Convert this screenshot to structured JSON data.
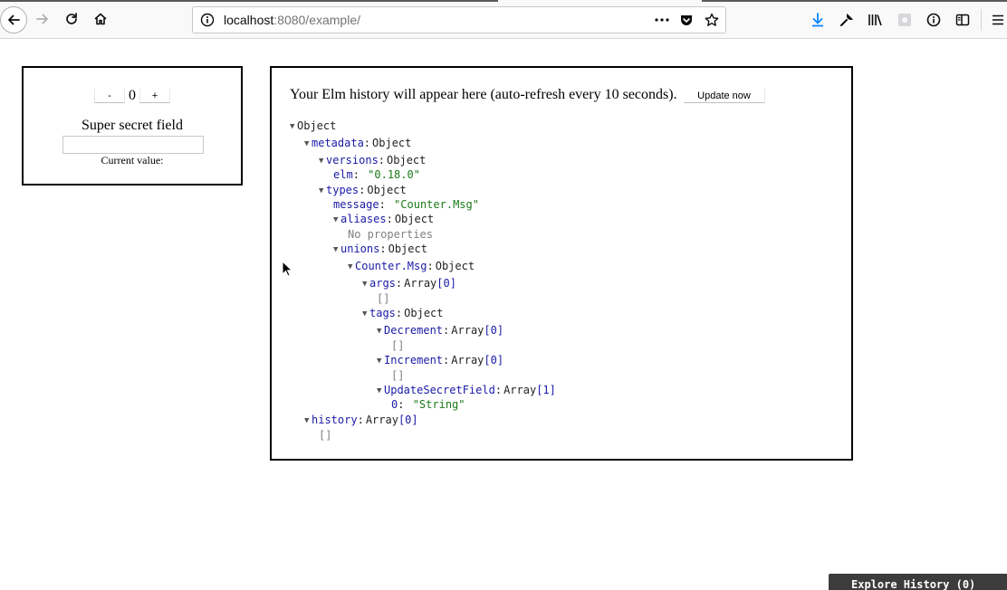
{
  "browser": {
    "url_host": "localhost",
    "url_rest": ":8080/example/",
    "icons": [
      "back-icon",
      "forward-icon",
      "reload-icon",
      "home-icon",
      "info-icon",
      "more-icon",
      "pocket-icon",
      "star-icon",
      "download-icon",
      "wrench-icon",
      "library-icon",
      "extension-icon",
      "info-circle-icon",
      "sidebar-icon",
      "menu-icon"
    ],
    "download_color": "#0a84ff"
  },
  "counter": {
    "decrement_label": "-",
    "count": "0",
    "increment_label": "+",
    "secret_label": "Super secret field",
    "secret_value": "",
    "current_value_label": "Current value:"
  },
  "history": {
    "message": "Your Elm history will appear here (auto-refresh every 10 seconds).",
    "update_label": "Update now",
    "tree": {
      "root": "Object",
      "metadata_key": "metadata",
      "metadata_type": "Object",
      "versions_key": "versions",
      "versions_type": "Object",
      "elm_key": "elm",
      "elm_value": "\"0.18.0\"",
      "types_key": "types",
      "types_type": "Object",
      "message_key": "message",
      "message_value": "\"Counter.Msg\"",
      "aliases_key": "aliases",
      "aliases_type": "Object",
      "no_props": "No properties",
      "unions_key": "unions",
      "unions_type": "Object",
      "countermsg_key": "Counter.Msg",
      "countermsg_type": "Object",
      "args_key": "args",
      "args_type": "Array",
      "args_len": "[0]",
      "args_empty": "[]",
      "tags_key": "tags",
      "tags_type": "Object",
      "decrement_key": "Decrement",
      "decrement_type": "Array",
      "decrement_len": "[0]",
      "decrement_empty": "[]",
      "increment_key": "Increment",
      "increment_type": "Array",
      "increment_len": "[0]",
      "increment_empty": "[]",
      "update_key": "UpdateSecretField",
      "update_type": "Array",
      "update_len": "[1]",
      "update_item_key": "0",
      "update_item_value": "\"String\"",
      "history_key": "history",
      "history_type": "Array",
      "history_len": "[0]",
      "history_empty": "[]"
    }
  },
  "explore": {
    "label": "Explore History (0)"
  }
}
